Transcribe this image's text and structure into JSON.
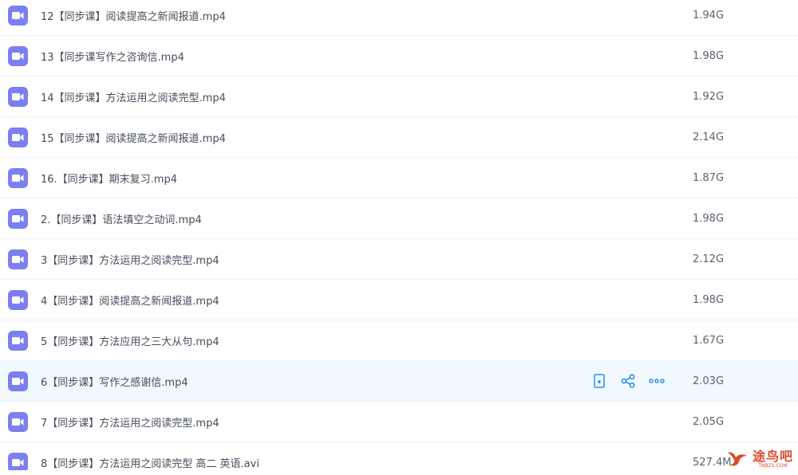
{
  "files": [
    {
      "name": "12【同步课】阅读提高之新闻报道.mp4",
      "size": "1.94G"
    },
    {
      "name": "13【同步课写作之咨询信.mp4",
      "size": "1.98G"
    },
    {
      "name": "14【同步课】方法运用之阅读完型.mp4",
      "size": "1.92G"
    },
    {
      "name": "15【同步课】阅读提高之新闻报道.mp4",
      "size": "2.14G"
    },
    {
      "name": "16.【同步课】期末复习.mp4",
      "size": "1.87G"
    },
    {
      "name": "2.【同步课】语法填空之动词.mp4",
      "size": "1.98G"
    },
    {
      "name": "3【同步课】方法运用之阅读完型.mp4",
      "size": "2.12G"
    },
    {
      "name": "4【同步课】阅读提高之新闻报道.mp4",
      "size": "1.98G"
    },
    {
      "name": "5【同步课】方法应用之三大从句.mp4",
      "size": "1.67G"
    },
    {
      "name": "6【同步课】写作之感谢信.mp4",
      "size": "2.03G"
    },
    {
      "name": "7【同步课】方法运用之阅读完型.mp4",
      "size": "2.05G"
    },
    {
      "name": "8【同步课】方法运用之阅读完型 高二 英语.avi",
      "size": "527.4M"
    }
  ],
  "hovered_row": 9,
  "icons": {
    "file": "video-file-icon",
    "actions": [
      "phone-icon",
      "share-icon",
      "more-icon"
    ]
  },
  "colors": {
    "icon_bg": "#7b7ff0",
    "action": "#2f8ff0",
    "hover_bg": "#f1f9ff",
    "watermark": "#e0492a"
  },
  "watermark": {
    "text": "途鸟吧",
    "sub": "TNBZS.COM"
  }
}
